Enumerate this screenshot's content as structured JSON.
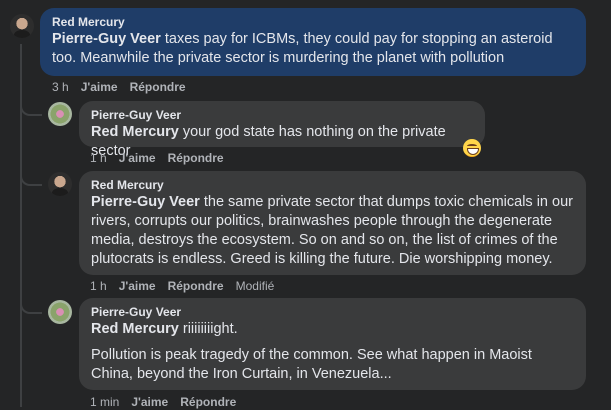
{
  "comments": [
    {
      "author": "Red Mercury",
      "mention": "Pierre-Guy Veer",
      "text": " taxes pay for ICBMs, they could pay for stopping an asteroid too. Meanwhile the private sector is murdering the planet with pollution",
      "time": "3 h",
      "like": "J'aime",
      "reply": "Répondre"
    },
    {
      "author": "Pierre-Guy Veer",
      "mention": "Red Mercury",
      "text": " your god state has nothing on the private sector",
      "time": "1 h",
      "like": "J'aime",
      "reply": "Répondre",
      "reaction_icon": "grinning-emoji-icon"
    },
    {
      "author": "Red Mercury",
      "mention": "Pierre-Guy Veer",
      "text": " the same private sector that dumps toxic chemicals in our rivers, corrupts our politics, brainwashes people through the degenerate media, destroys the ecosystem. So on and so on, the list of crimes of the plutocrats is endless. Greed is killing the future. Die worshipping money.",
      "time": "1 h",
      "like": "J'aime",
      "reply": "Répondre",
      "edited": "Modifié"
    },
    {
      "author": "Pierre-Guy Veer",
      "mention": "Red Mercury",
      "text": " riiiiiiiight.",
      "text2": "Pollution is peak tragedy of the common. See what happen in Maoist China, beyond the Iron Curtain, in Venezuela...",
      "time": "1 min",
      "like": "J'aime",
      "reply": "Répondre"
    }
  ],
  "colors": {
    "background": "#242526",
    "highlight_bubble": "#1f3d68",
    "bubble": "#3a3b3c",
    "text": "#e4e6eb",
    "meta": "#b0b3b8"
  }
}
